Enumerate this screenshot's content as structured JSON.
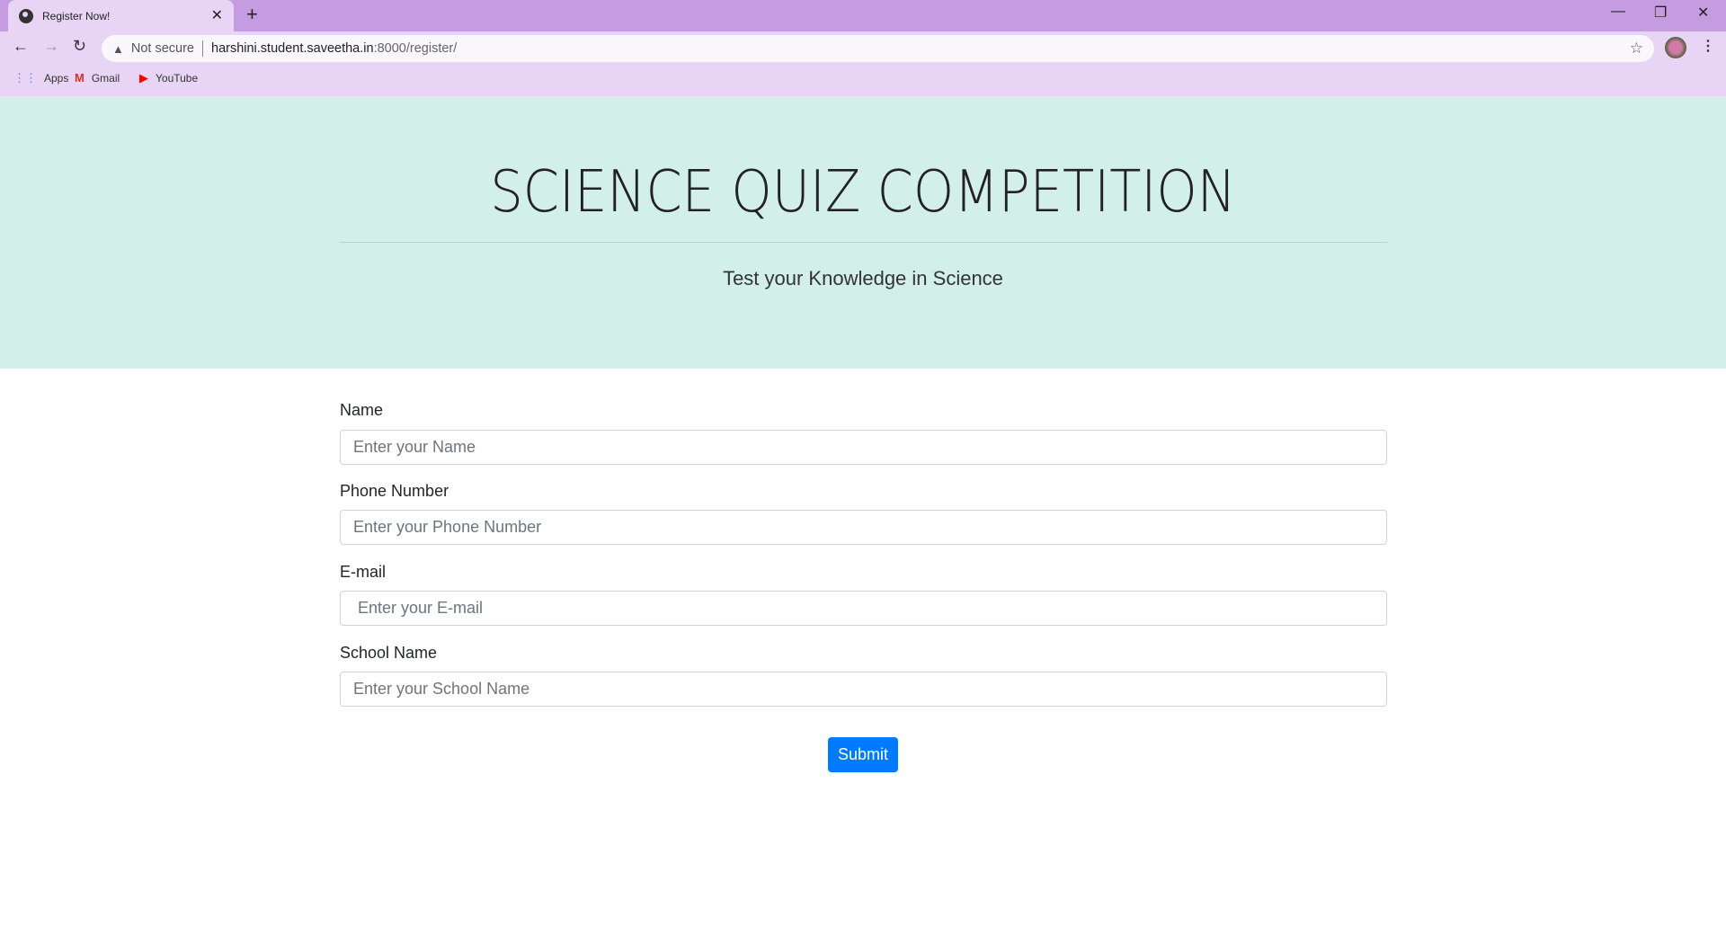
{
  "browser": {
    "tab_title": "Register Now!",
    "security": "Not secure",
    "url_host": "harshini.student.saveetha.in",
    "url_path": ":8000/register/",
    "bookmarks": [
      {
        "label": "Apps"
      },
      {
        "label": "Gmail"
      },
      {
        "label": "YouTube"
      }
    ]
  },
  "hero": {
    "title": "SCIENCE QUIZ COMPETITION",
    "subtitle": "Test your Knowledge in Science"
  },
  "form": {
    "fields": [
      {
        "label": "Name",
        "placeholder": "Enter your Name"
      },
      {
        "label": "Phone Number",
        "placeholder": "Enter your Phone Number"
      },
      {
        "label": "E-mail",
        "placeholder": " Enter your E-mail"
      },
      {
        "label": "School Name",
        "placeholder": "Enter your School Name"
      }
    ],
    "submit_label": "Submit"
  },
  "colors": {
    "tabbar": "#c59ce2",
    "toolbar": "#e8d5f5",
    "hero": "#d3efe9",
    "primary": "#007bff"
  }
}
